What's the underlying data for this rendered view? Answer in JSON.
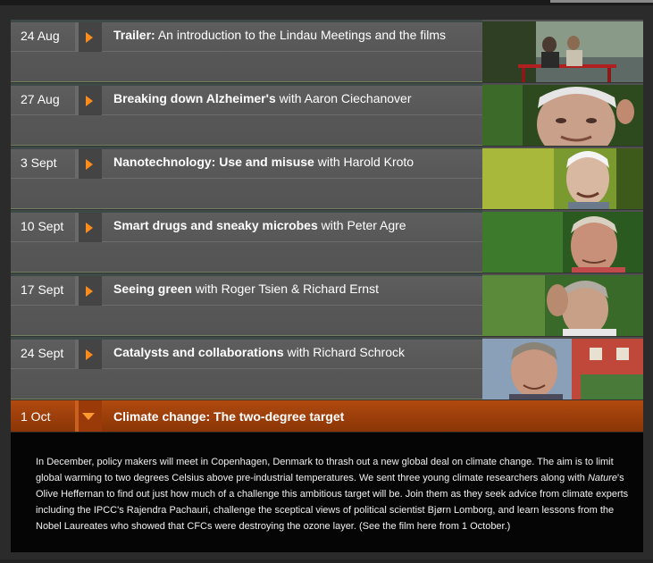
{
  "episodes": [
    {
      "date": "24 Aug",
      "bold": "Trailer:",
      "rest": " An introduction to the Lindau Meetings and the films",
      "thumb": "two people on bench by lake"
    },
    {
      "date": "27 Aug",
      "bold": "Breaking down Alzheimer's",
      "rest": " with Aaron Ciechanover",
      "thumb": "portrait grey-haired man"
    },
    {
      "date": "3 Sept",
      "bold": "Nanotechnology: Use and misuse",
      "rest": " with Harold Kroto",
      "thumb": "smiling white-haired man"
    },
    {
      "date": "10 Sept",
      "bold": "Smart drugs and sneaky microbes",
      "rest": " with Peter Agre",
      "thumb": "man by trees"
    },
    {
      "date": "17 Sept",
      "bold": "Seeing green",
      "rest": " with Roger Tsien & Richard Ernst",
      "thumb": "man with hand on head"
    },
    {
      "date": "24 Sept",
      "bold": "Catalysts and collaborations",
      "rest": " with Richard Schrock",
      "thumb": "smiling man by houses"
    }
  ],
  "active": {
    "date": "1 Oct",
    "title": "Climate change: The two-degree target",
    "description_part1": "In December, policy makers will meet in Copenhagen, Denmark to thrash out a new global deal on climate change. The aim is to limit global warming to two degrees Celsius above pre-industrial temperatures. We sent three young climate researchers along with ",
    "description_italic": "Nature",
    "description_part2": "'s Olive Heffernan to find out just how much of a challenge this ambitious target will be. Join them as they seek advice from climate experts including the IPCC's Rajendra Pachauri, challenge the sceptical views of political scientist Bjørn Lomborg, and learn lessons from the Nobel Laureates who showed that CFCs were destroying the ozone layer. (See the film here from 1 October.)"
  },
  "colors": {
    "accent": "#ff8c1a",
    "active_bg": "#a3430d",
    "row_bg": "#585858"
  }
}
